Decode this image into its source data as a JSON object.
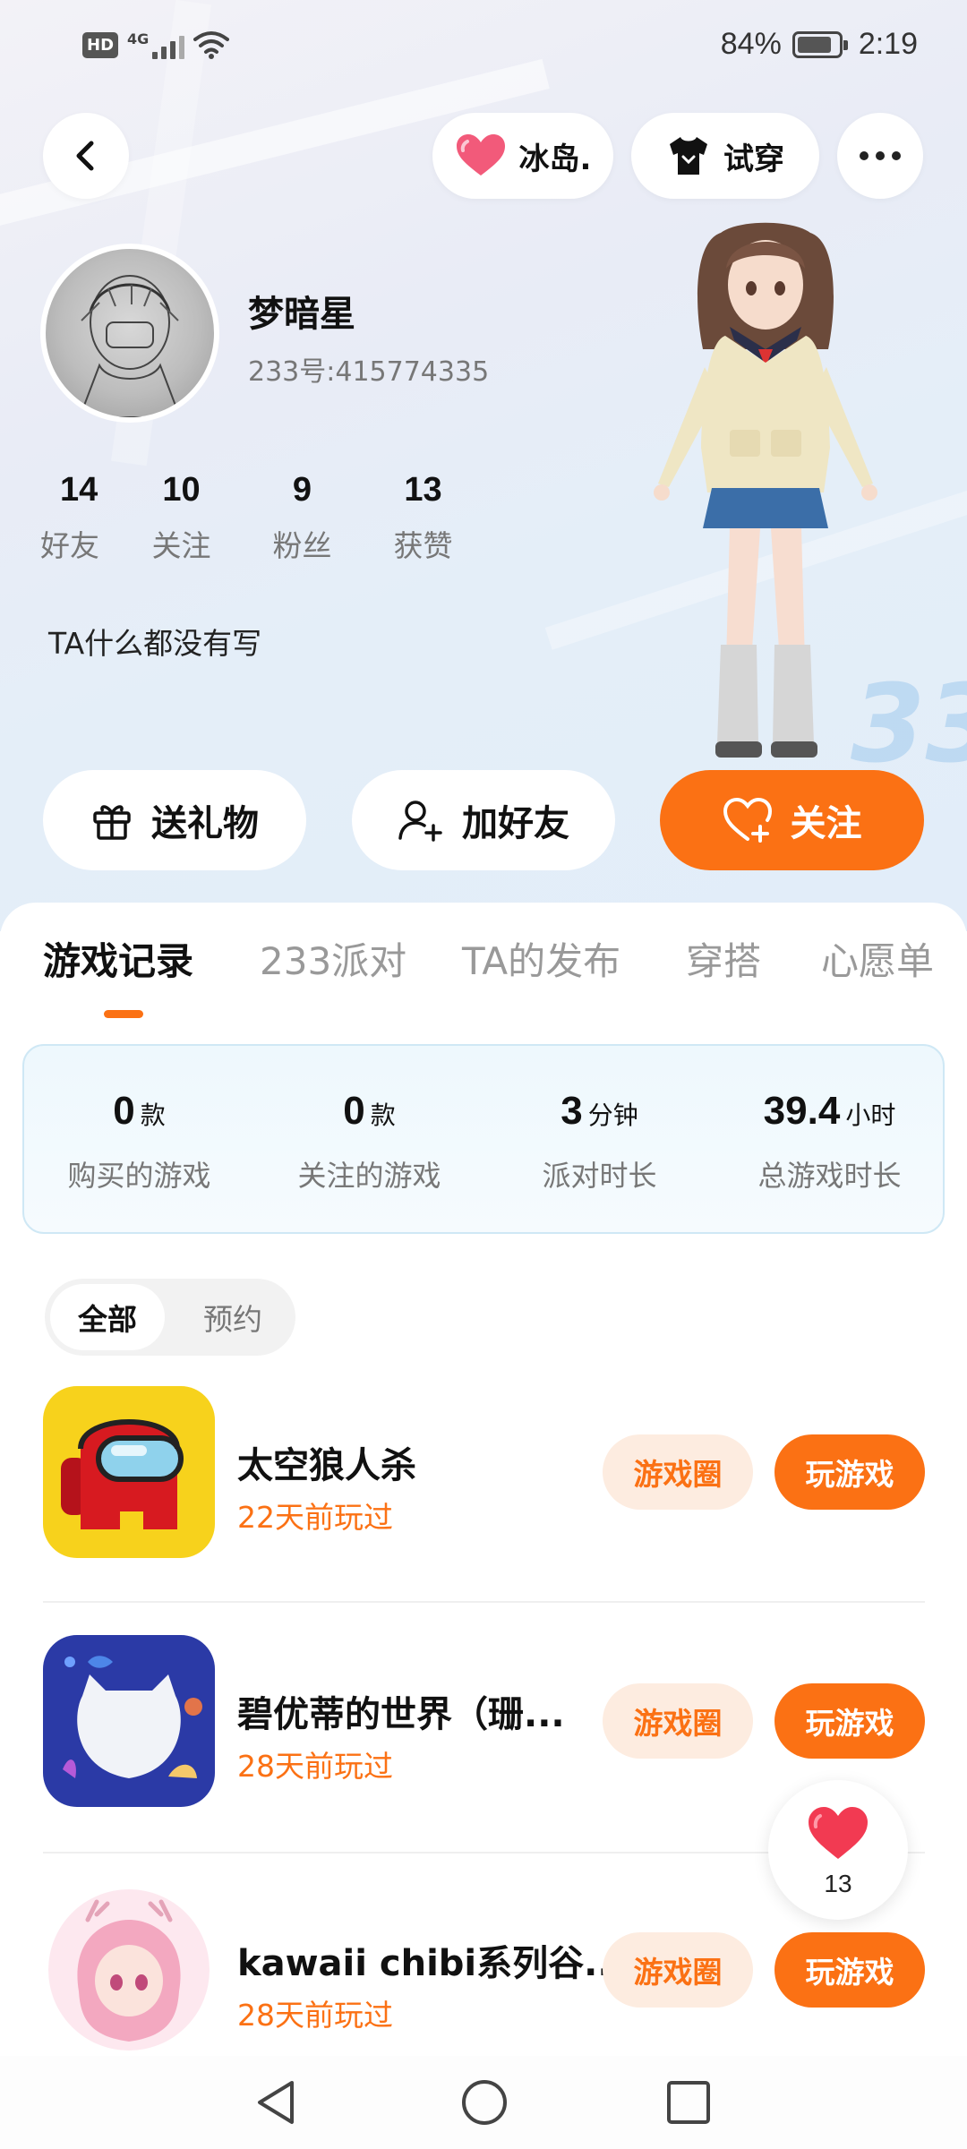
{
  "status_bar": {
    "hd": "HD",
    "network": "4G",
    "battery_percent": "84%",
    "battery_level": 0.84,
    "time": "2:19"
  },
  "top_actions": {
    "ice_label": "冰岛.",
    "try_on_label": "试穿"
  },
  "profile": {
    "nickname": "梦暗星",
    "uid": "233号:415774335",
    "bio": "TA什么都没有写",
    "stats": [
      {
        "num": "14",
        "label": "好友"
      },
      {
        "num": "10",
        "label": "关注"
      },
      {
        "num": "9",
        "label": "粉丝"
      },
      {
        "num": "13",
        "label": "获赞"
      }
    ]
  },
  "actions": {
    "gift": "送礼物",
    "add_friend": "加好友",
    "follow": "关注"
  },
  "tabs": [
    "游戏记录",
    "233派对",
    "TA的发布",
    "穿搭",
    "心愿单"
  ],
  "active_tab": 0,
  "game_stats": [
    {
      "value": "0",
      "unit": "款",
      "label": "购买的游戏"
    },
    {
      "value": "0",
      "unit": "款",
      "label": "关注的游戏"
    },
    {
      "value": "3",
      "unit": "分钟",
      "label": "派对时长"
    },
    {
      "value": "39.4",
      "unit": "小时",
      "label": "总游戏时长"
    }
  ],
  "filter": {
    "all": "全部",
    "reserve": "预约"
  },
  "games": [
    {
      "name": "太空狼人杀",
      "played": "22天前玩过",
      "circle": "游戏圈",
      "play": "玩游戏"
    },
    {
      "name": "碧优蒂的世界（珊...",
      "played": "28天前玩过",
      "circle": "游戏圈",
      "play": "玩游戏"
    },
    {
      "name": "kawaii chibi系列谷...",
      "played": "28天前玩过",
      "circle": "游戏圈",
      "play": "玩游戏"
    }
  ],
  "like_count": "13",
  "colors": {
    "accent": "#fb7114",
    "accent_light": "#fdece0",
    "heart": "#f25a7a"
  }
}
